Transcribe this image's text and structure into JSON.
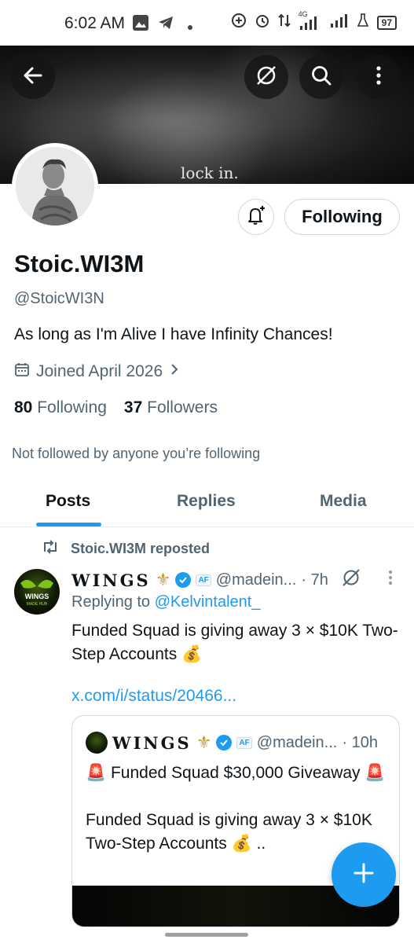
{
  "status_bar": {
    "time": "6:02 AM",
    "network": "4G",
    "battery": "97"
  },
  "banner": {
    "text": "lock in."
  },
  "profile": {
    "display_name": "Stoic.WI3M",
    "handle": "@StoicWI3N",
    "bio": "As long as I'm Alive I have Infinity Chances!",
    "joined": "Joined April 2026",
    "following_count": "80",
    "following_label": "Following",
    "followers_count": "37",
    "followers_label": "Followers",
    "not_followed": "Not followed by anyone you’re following",
    "follow_button_label": "Following"
  },
  "tabs": [
    {
      "label": "Posts"
    },
    {
      "label": "Replies"
    },
    {
      "label": "Media"
    }
  ],
  "tweet": {
    "repost_label": "Stoic.WI3M reposted",
    "author_name": "WINGS",
    "author_emoji": "⚜",
    "affiliate": "AF",
    "author_handle": "@madein...",
    "time": "· 7h",
    "replying_prefix": "Replying to ",
    "replying_to": "@Kelvintalent_",
    "body": "Funded Squad is giving away 3 × $10K Two-Step Accounts 💰",
    "link": "x.com/i/status/20466...",
    "avatar_text_1": "WINGS",
    "avatar_text_2": "MADE HUB",
    "quote": {
      "author_name": "WINGS",
      "author_emoji": "⚜",
      "affiliate": "AF",
      "author_handle": "@madein...",
      "time": "· 10h",
      "line1": "🚨 Funded Squad $30,000 Giveaway 🚨",
      "line2": "Funded Squad is giving away 3 × $10K Two-Step Accounts 💰 .."
    }
  },
  "colors": {
    "accent": "#1d9bf0",
    "text_primary": "#0f1419",
    "text_secondary": "#536471",
    "border": "#cfd9de"
  },
  "icons": {
    "back": "arrow-left-icon",
    "grok": "grok-icon",
    "search": "search-icon",
    "more": "more-vertical-icon",
    "bell": "bell-plus-icon",
    "calendar": "calendar-icon",
    "chevron": "chevron-right-icon",
    "repost": "repost-icon",
    "verified": "verified-icon",
    "compose": "plus-icon"
  }
}
